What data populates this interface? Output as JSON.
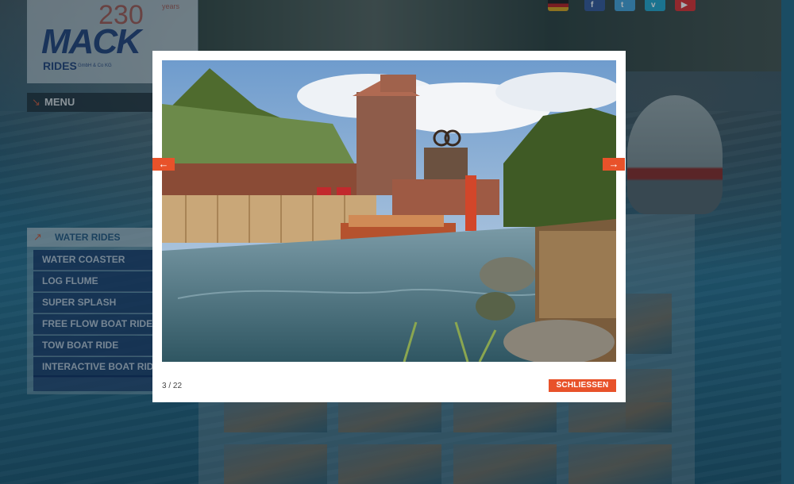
{
  "logo": {
    "years_number": "230",
    "years_text": "years",
    "brand": "MACK",
    "rides": "RIDES",
    "legal": "GmbH & Co KG"
  },
  "menu": {
    "label": "MENU"
  },
  "social_icons": [
    "flag-de-icon",
    "facebook-icon",
    "twitter-icon",
    "vimeo-icon",
    "youtube-icon"
  ],
  "sidebar": {
    "heading": "WATER RIDES",
    "items": [
      "WATER COASTER",
      "LOG FLUME",
      "SUPER SPLASH",
      "FREE FLOW BOAT RIDES",
      "TOW BOAT RIDE",
      "INTERACTIVE BOAT RIDE"
    ]
  },
  "lightbox": {
    "counter": "3 / 22",
    "close_label": "SCHLIESSEN",
    "prev_icon": "arrow-left-icon",
    "next_icon": "arrow-right-icon",
    "accent_color": "#e8522a"
  }
}
